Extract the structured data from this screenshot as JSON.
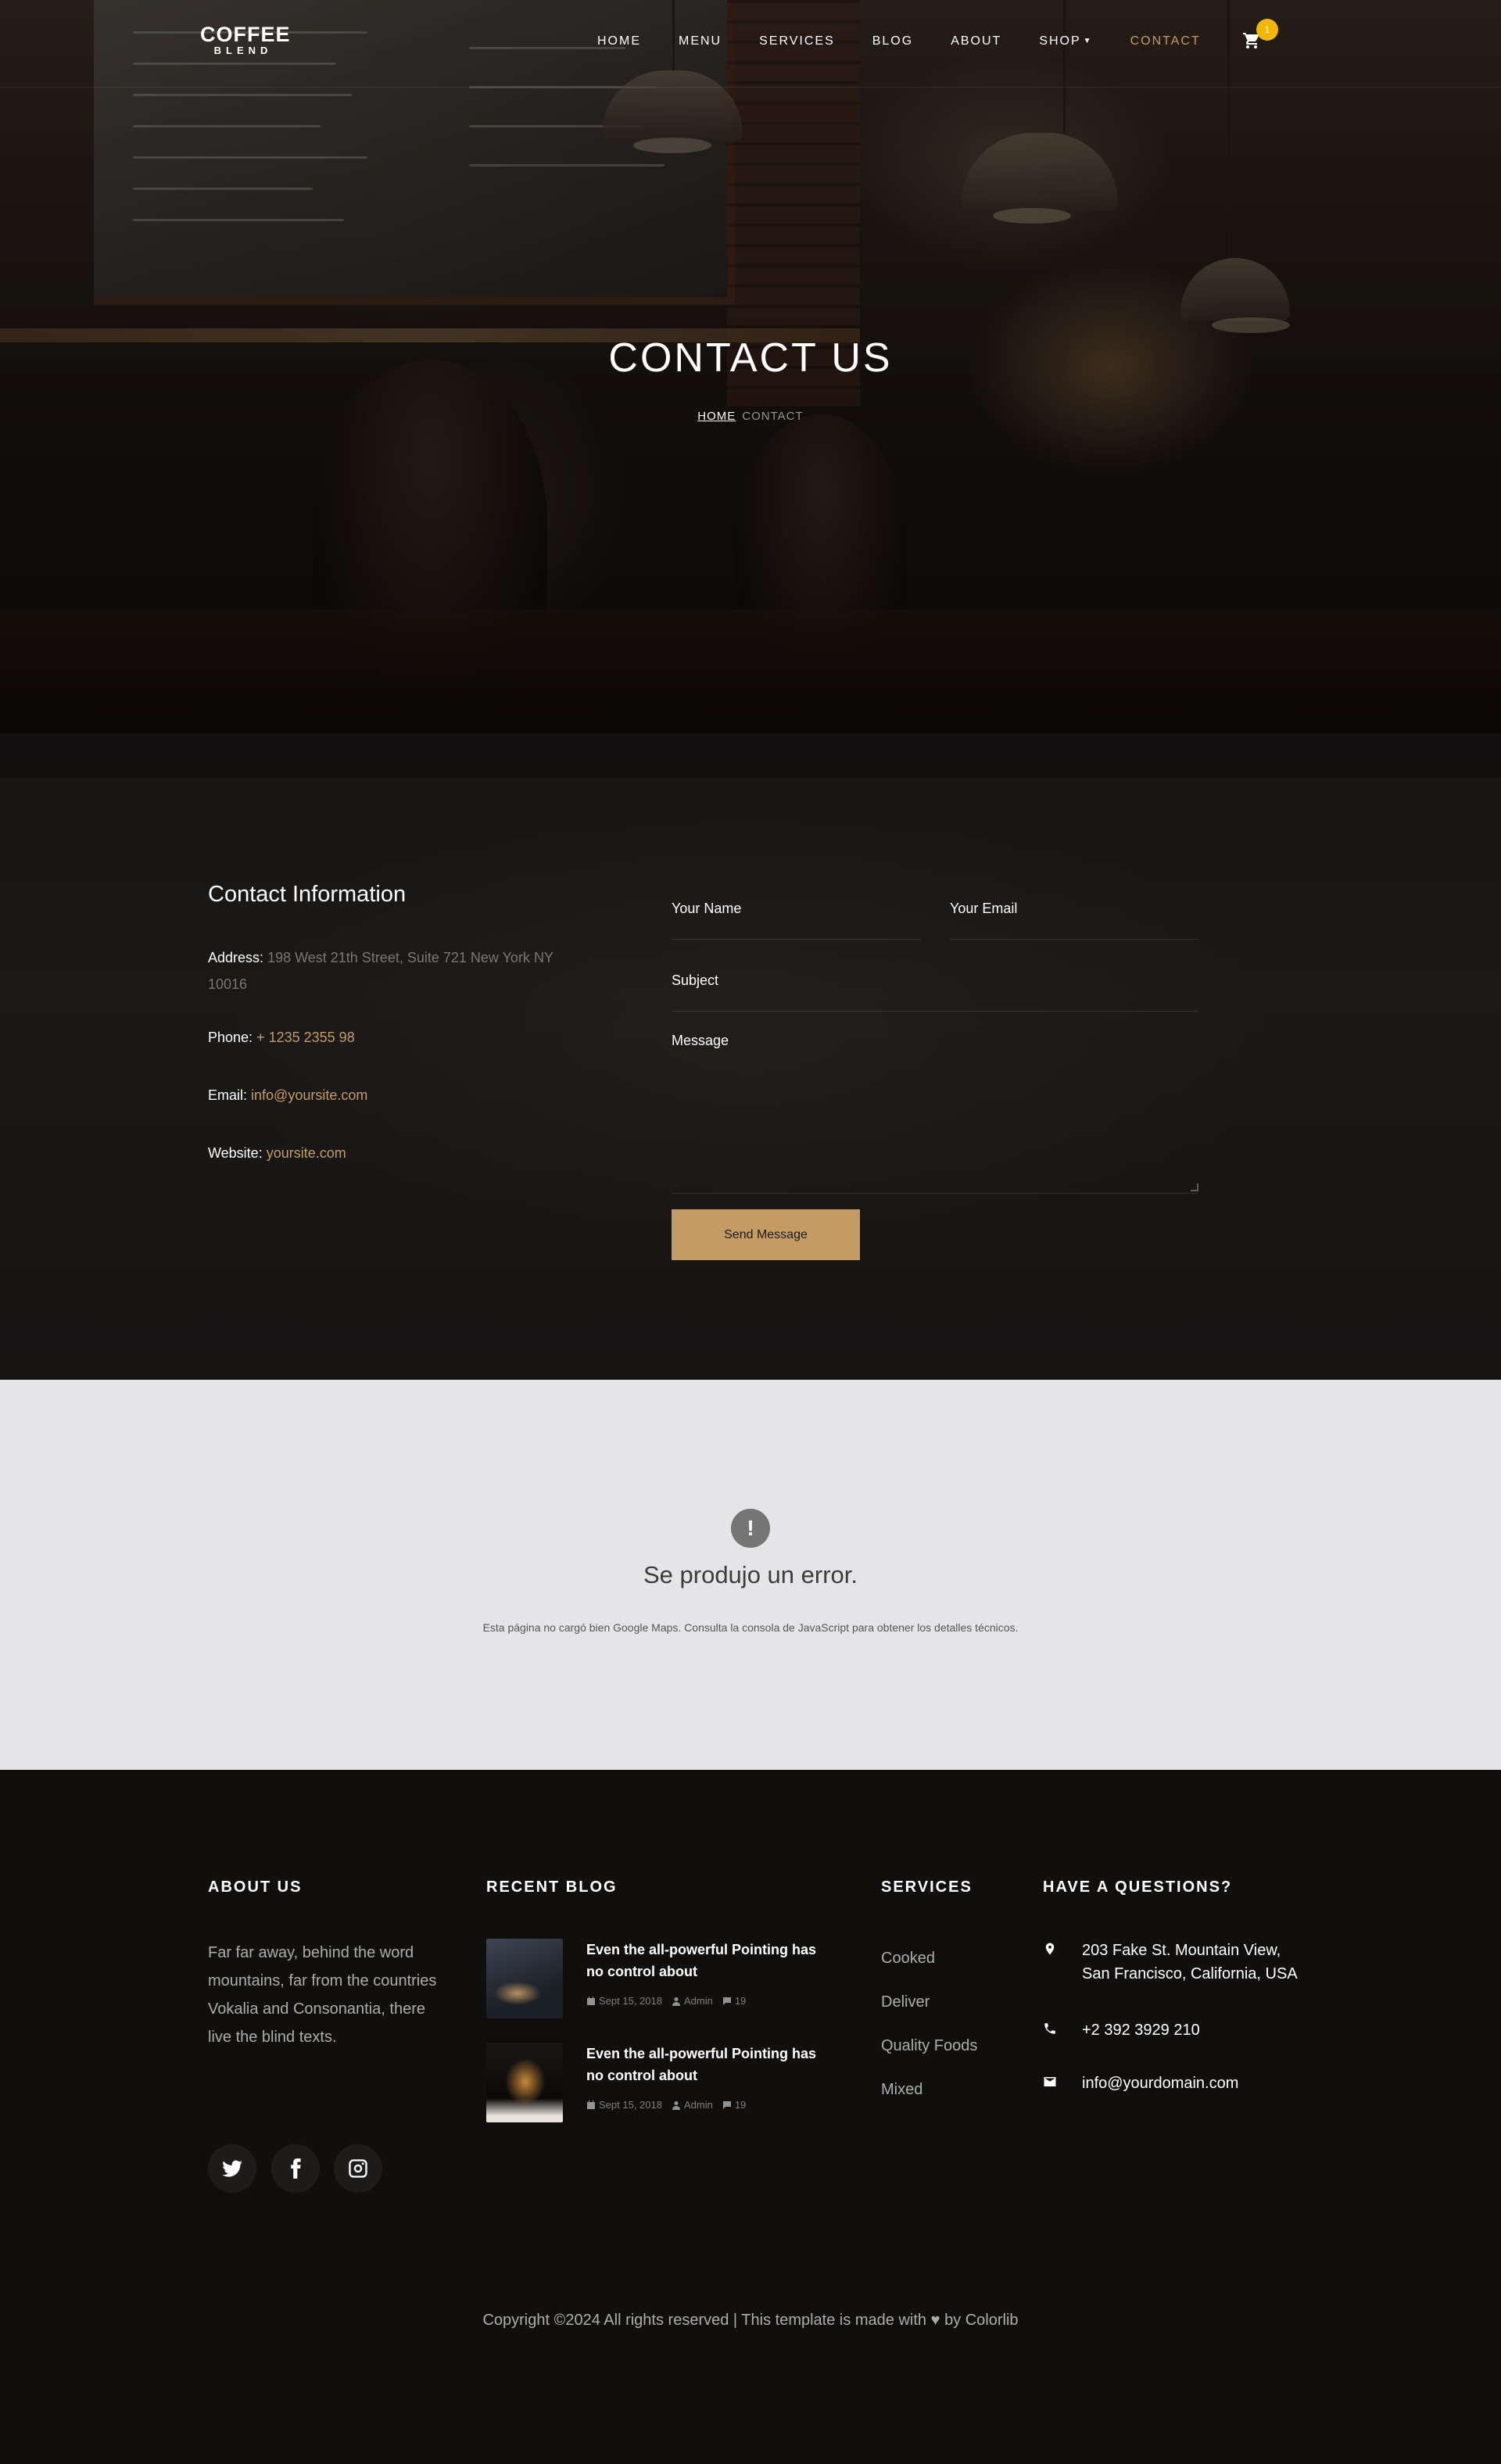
{
  "nav": {
    "logo_top": "COFFEE",
    "logo_bottom": "BLEND",
    "items": [
      {
        "label": "HOME"
      },
      {
        "label": "MENU"
      },
      {
        "label": "SERVICES"
      },
      {
        "label": "BLOG"
      },
      {
        "label": "ABOUT"
      },
      {
        "label": "SHOP",
        "has_dropdown": true
      },
      {
        "label": "CONTACT",
        "active": true
      }
    ],
    "cart_icon": "shopping-cart-icon",
    "cart_count": "1"
  },
  "hero": {
    "title": "CONTACT US",
    "breadcrumb": {
      "home": "HOME",
      "current": "CONTACT"
    }
  },
  "contact_info": {
    "title": "Contact Information",
    "address_label": "Address:",
    "address_value": "198 West 21th Street, Suite 721 New York NY 10016",
    "phone_label": "Phone:",
    "phone_value": "+ 1235 2355 98",
    "email_label": "Email:",
    "email_value": "info@yoursite.com",
    "website_label": "Website:",
    "website_value": "yoursite.com"
  },
  "form": {
    "name_placeholder": "Your Name",
    "email_placeholder": "Your Email",
    "subject_placeholder": "Subject",
    "message_placeholder": "Message",
    "submit_label": "Send Message"
  },
  "map_error": {
    "icon": "exclamation-icon",
    "title": "Se produjo un error.",
    "detail": "Esta página no cargó bien Google Maps. Consulta la consola de JavaScript para obtener los detalles técnicos."
  },
  "footer": {
    "about": {
      "heading": "ABOUT US",
      "text": "Far far away, behind the word mountains, far from the countries Vokalia and Consonantia, there live the blind texts."
    },
    "social": [
      {
        "icon": "twitter-icon"
      },
      {
        "icon": "facebook-icon"
      },
      {
        "icon": "instagram-icon"
      }
    ],
    "blog": {
      "heading": "RECENT BLOG",
      "posts": [
        {
          "title": "Even the all-powerful Pointing has no control about",
          "date": "Sept 15, 2018",
          "author": "Admin",
          "comments": "19"
        },
        {
          "title": "Even the all-powerful Pointing has no control about",
          "date": "Sept 15, 2018",
          "author": "Admin",
          "comments": "19"
        }
      ]
    },
    "services": {
      "heading": "SERVICES",
      "items": [
        "Cooked",
        "Deliver",
        "Quality Foods",
        "Mixed"
      ]
    },
    "questions": {
      "heading": "HAVE A QUESTIONS?",
      "address": "203 Fake St. Mountain View, San Francisco, California, USA",
      "phone": "+2 392 3929 210",
      "email": "info@yourdomain.com"
    },
    "copyright_before": "Copyright ©2024 All rights reserved | This template is made with",
    "copyright_after": "by Colorlib"
  },
  "colors": {
    "accent": "#c49b63",
    "badge": "#f2b705",
    "dark_bg": "#110f0e",
    "map_bg": "#e5e5e8"
  }
}
